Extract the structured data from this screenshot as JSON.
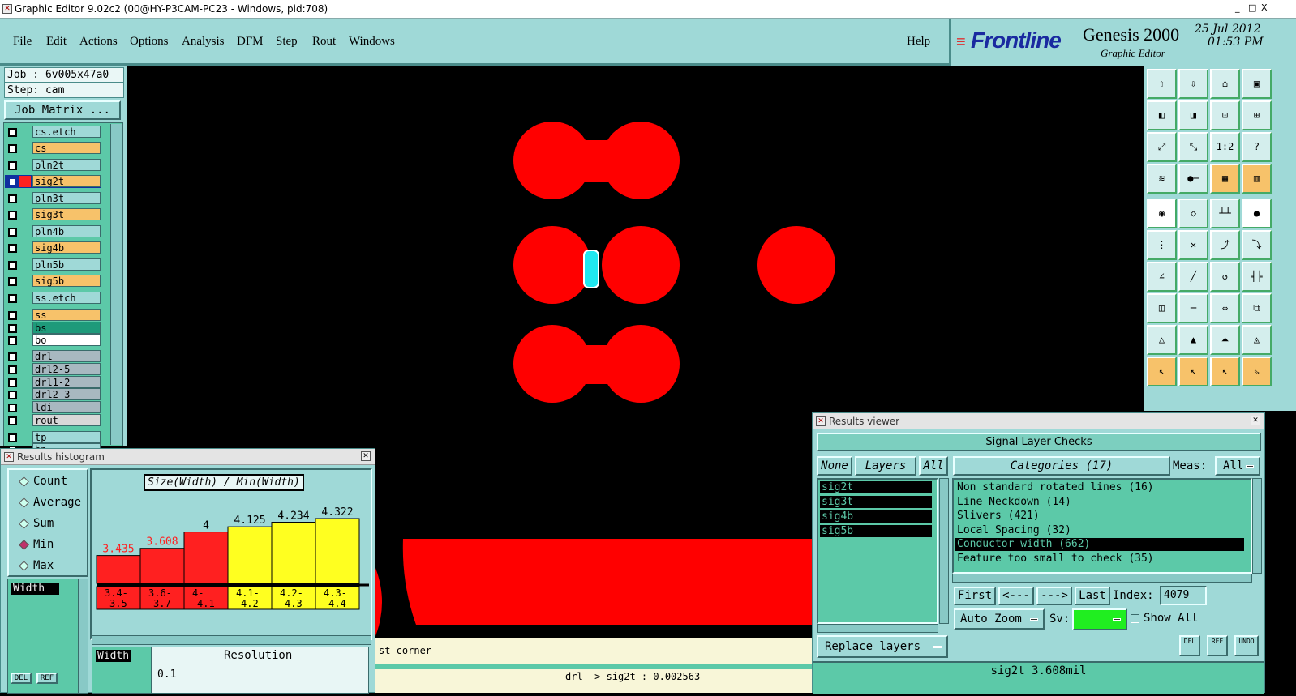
{
  "window": {
    "title": "Graphic Editor 9.02c2 (00@HY-P3CAM-PC23 - Windows, pid:708)",
    "controls": [
      "_",
      "□",
      "X"
    ]
  },
  "menu": {
    "items": [
      "File",
      "Edit",
      "Actions",
      "Options",
      "Analysis",
      "DFM",
      "Step",
      "Rout",
      "Windows"
    ],
    "help": "Help"
  },
  "brand": {
    "logo": "Frontline",
    "product": "Genesis 2000",
    "subtitle": "Graphic Editor",
    "date": "25 Jul 2012",
    "time": "01:53 PM"
  },
  "job": {
    "job": "Job : 6v005x47a0",
    "step": "Step: cam",
    "matrix_button": "Job Matrix ..."
  },
  "layers": [
    {
      "name": "cs.etch",
      "color": "#9fd9d7"
    },
    {
      "name": "cs",
      "color": "#f7c26a"
    },
    {
      "name": "pln2t",
      "color": "#9fd9d7"
    },
    {
      "name": "sig2t",
      "color": "#f7c26a",
      "active": true
    },
    {
      "name": "pln3t",
      "color": "#9fd9d7"
    },
    {
      "name": "sig3t",
      "color": "#f7c26a"
    },
    {
      "name": "pln4b",
      "color": "#9fd9d7"
    },
    {
      "name": "sig4b",
      "color": "#f7c26a"
    },
    {
      "name": "pln5b",
      "color": "#9fd9d7"
    },
    {
      "name": "sig5b",
      "color": "#f7c26a"
    },
    {
      "name": "ss.etch",
      "color": "#9fd9d7"
    },
    {
      "name": "ss",
      "color": "#f7c26a"
    },
    {
      "name": "bs",
      "color": "#1e9a7a"
    },
    {
      "name": "bo",
      "color": "#ffffff"
    },
    {
      "name": "drl",
      "color": "#a8b8c0"
    },
    {
      "name": "drl2-5",
      "color": "#a8b8c0"
    },
    {
      "name": "drl1-2",
      "color": "#a8b8c0"
    },
    {
      "name": "drl2-3",
      "color": "#a8b8c0"
    },
    {
      "name": "ldi",
      "color": "#a8b8c0"
    },
    {
      "name": "rout",
      "color": "#d8d8d8"
    },
    {
      "name": "tp",
      "color": "#9fd9d7"
    },
    {
      "name": "bp",
      "color": "#9fd9d7"
    }
  ],
  "toolbar": {
    "rows": [
      [
        "home-in",
        "home-out",
        "home",
        "window"
      ],
      [
        "pan-left",
        "pan-right",
        "fit",
        "zoom"
      ],
      [
        "expand",
        "shrink",
        "1:2",
        "?"
      ],
      [
        "measure",
        "snap",
        "grid",
        "net"
      ],
      [
        "pad",
        "poly",
        "ruler",
        "dot"
      ],
      [
        "node",
        "cross",
        "connect",
        "route"
      ],
      [
        "line",
        "slash",
        "arc",
        "fence"
      ],
      [
        "move",
        "dash",
        "stretch",
        "copy"
      ],
      [
        "tri1",
        "tri2",
        "tri3",
        "tri4"
      ],
      [
        "select",
        "select2",
        "select3",
        "step"
      ]
    ],
    "labels": {
      "1:2": "1:2",
      "?": "?"
    }
  },
  "histogram": {
    "title": "Results histogram",
    "modes": [
      "Count",
      "Average",
      "Sum",
      "Min",
      "Max"
    ],
    "selected_mode": "Min",
    "header": "Size(Width) / Min(Width)",
    "field": "Width",
    "field2": "Width",
    "resolution_label": "Resolution",
    "resolution_value": "0.1",
    "bottom_buttons": [
      "DEL",
      "REF"
    ],
    "chart_data": {
      "type": "bar",
      "categories": [
        "3.4-3.5",
        "3.6-3.7",
        "4-4.1",
        "4.1-4.2",
        "4.2-4.3",
        "4.3-4.4"
      ],
      "cat_lines": [
        [
          "3.4-",
          "3.5"
        ],
        [
          "3.6-",
          "3.7"
        ],
        [
          "4-",
          "4.1"
        ],
        [
          "4.1-",
          "4.2"
        ],
        [
          "4.2-",
          "4.3"
        ],
        [
          "4.3-",
          "4.4"
        ]
      ],
      "values": [
        3.435,
        3.608,
        4,
        4.125,
        4.234,
        4.322
      ],
      "value_labels": [
        "3.435",
        "3.608",
        "4",
        "4.125",
        "4.234",
        "4.322"
      ],
      "colors": [
        "#ff2020",
        "#ff2020",
        "#ff2020",
        "#ffff20",
        "#ffff20",
        "#ffff20"
      ],
      "label_colors": [
        "#ff2020",
        "#ff2020",
        "#000000",
        "#000000",
        "#000000",
        "#000000"
      ]
    }
  },
  "results": {
    "title": "Results viewer",
    "group": "Signal Layer Checks",
    "none_btn": "None",
    "layers_btn": "Layers",
    "all_btn": "All",
    "categories_btn": "Categories (17)",
    "meas_label": "Meas:",
    "meas_value": "All",
    "layer_list": [
      "sig2t",
      "sig3t",
      "sig4b",
      "sig5b"
    ],
    "categories": [
      "Non standard rotated lines (16)",
      "Line Neckdown (14)",
      "Slivers (421)",
      "Local Spacing (32)",
      "Conductor width (662)",
      "Feature too small to check (35)"
    ],
    "selected_category": "Conductor width (662)",
    "nav": {
      "first": "First",
      "prev": "<---",
      "next": "--->",
      "last": "Last",
      "index_label": "Index:",
      "index_value": "4079"
    },
    "auto_zoom": "Auto Zoom",
    "sv_label": "Sv:",
    "show_all": "Show All",
    "replace_layers": "Replace layers",
    "bottom_buttons": [
      "DEL",
      "REF",
      "UNDO"
    ],
    "status": "sig2t 3.608mil"
  },
  "status": {
    "message": "st corner",
    "readout": "drl -> sig2t : 0.002563"
  }
}
